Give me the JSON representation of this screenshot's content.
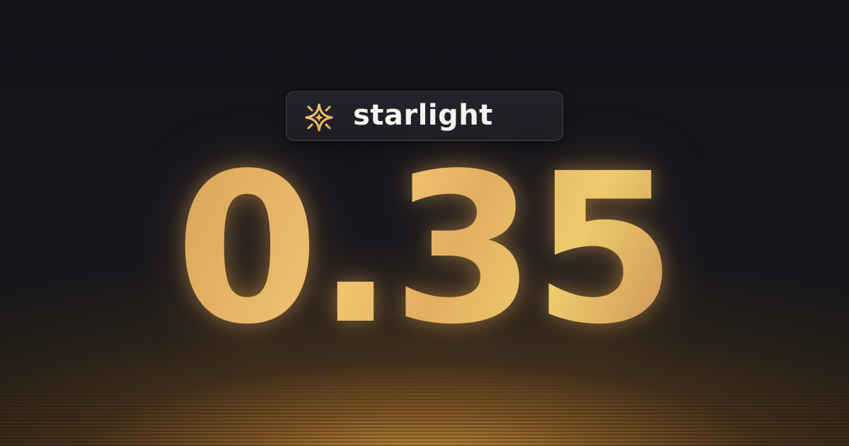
{
  "brand": {
    "name": "starlight",
    "logo_icon": "sparkle-star-icon"
  },
  "headline": {
    "version": "0.35"
  },
  "colors": {
    "background": "#16151d",
    "accent_gold": "#e9b466",
    "glow": "#ecaa46",
    "badge_bg": "#1f1e26",
    "brand_text": "#f5f3ee"
  }
}
